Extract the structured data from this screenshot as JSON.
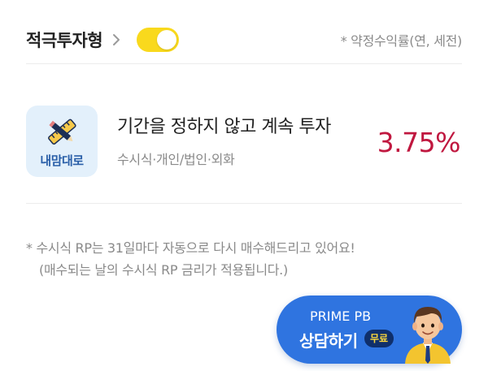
{
  "header": {
    "type_label": "적극투자형",
    "toggle_on": true,
    "note": "* 약정수익률(연, 세전)"
  },
  "product": {
    "icon_text": "내맘대로",
    "title": "기간을 정하지 않고 계속 투자",
    "subtitle": "수시식·개인/법인·외화",
    "rate": "3.75%"
  },
  "footnote": {
    "line1": "* 수시식 RP는 31일마다 자동으로 다시 매수해드리고 있어요!",
    "line2": "(매수되는 날의 수시식 RP 금리가 적용됩니다.)"
  },
  "consult": {
    "line1": "PRIME PB",
    "line2": "상담하기",
    "badge": "무료"
  },
  "colors": {
    "toggle": "#f9d91d",
    "rate": "#c0173f",
    "button": "#2f74e0"
  }
}
